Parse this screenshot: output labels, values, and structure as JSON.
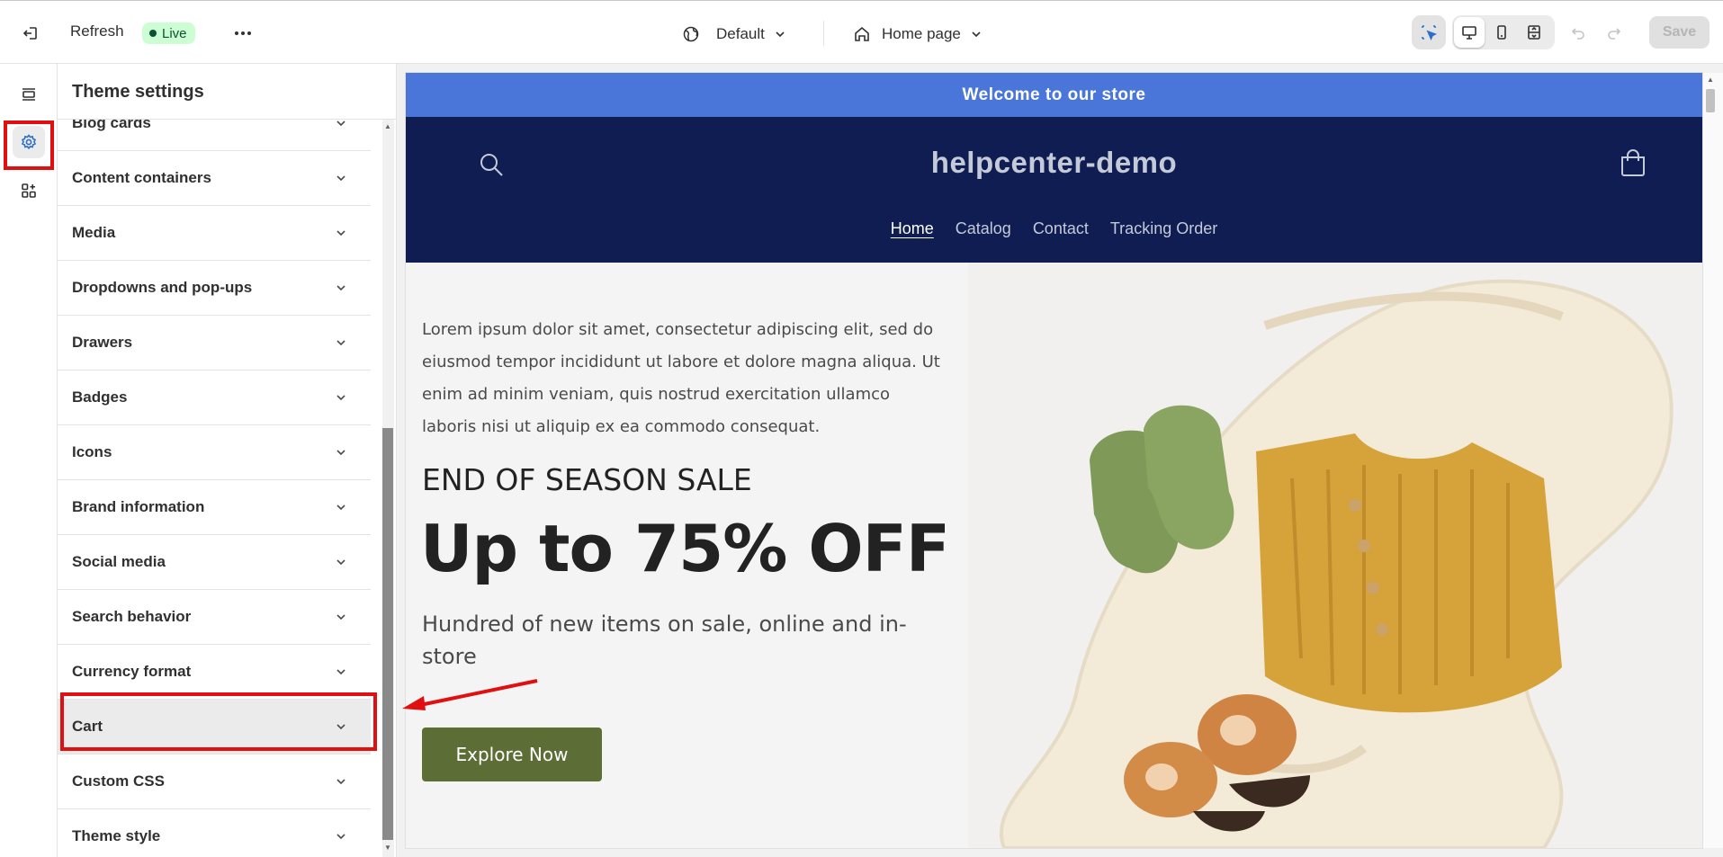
{
  "topbar": {
    "refresh_label": "Refresh",
    "live_label": "Live",
    "theme_label": "Default",
    "page_label": "Home page",
    "save_label": "Save",
    "icons": [
      "exit-icon",
      "more-icon",
      "globe-icon",
      "home-icon",
      "inspector-icon",
      "desktop-icon",
      "mobile-icon",
      "fullscreen-icon",
      "undo-icon",
      "redo-icon"
    ]
  },
  "rail": {
    "items": [
      "sections",
      "theme-settings",
      "apps"
    ]
  },
  "panel": {
    "title": "Theme settings",
    "items": [
      {
        "label": "Blog cards"
      },
      {
        "label": "Content containers"
      },
      {
        "label": "Media"
      },
      {
        "label": "Dropdowns and pop-ups"
      },
      {
        "label": "Drawers"
      },
      {
        "label": "Badges"
      },
      {
        "label": "Icons"
      },
      {
        "label": "Brand information"
      },
      {
        "label": "Social media"
      },
      {
        "label": "Search behavior"
      },
      {
        "label": "Currency format"
      },
      {
        "label": "Cart"
      },
      {
        "label": "Custom CSS"
      },
      {
        "label": "Theme style"
      }
    ],
    "active_item": "Cart"
  },
  "preview": {
    "announcement": "Welcome to our store",
    "store_name": "helpcenter-demo",
    "nav": [
      "Home",
      "Catalog",
      "Contact",
      "Tracking Order"
    ],
    "hero": {
      "body": "Lorem ipsum dolor sit amet, consectetur adipiscing elit, sed do eiusmod tempor incididunt ut labore et dolore magna aliqua. Ut enim ad minim veniam, quis nostrud exercitation ullamco laboris nisi ut aliquip ex ea commodo consequat.",
      "kicker": "END OF SEASON SALE",
      "headline": "Up to 75% OFF",
      "subtext": "Hundred of new items on sale, online and in-store",
      "cta": "Explore Now"
    }
  },
  "colors": {
    "announcement_bg": "#4a76d9",
    "header_bg": "#0f1d52",
    "button_bg": "#5c6e36",
    "highlight": "#e01010",
    "live_badge_bg": "#cdfed3"
  }
}
